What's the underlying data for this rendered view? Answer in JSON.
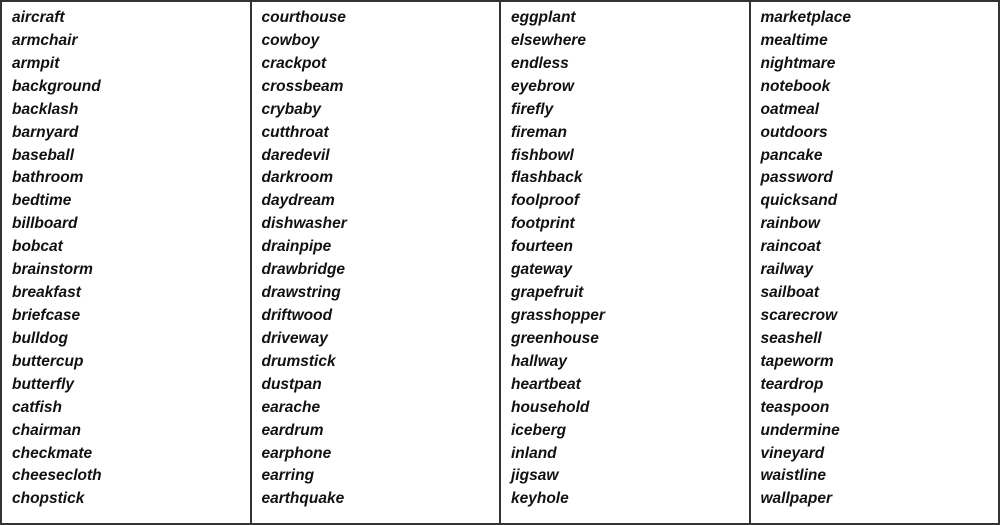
{
  "columns": [
    {
      "id": "col1",
      "words": [
        "aircraft",
        "armchair",
        "armpit",
        "background",
        "backlash",
        "barnyard",
        "baseball",
        "bathroom",
        "bedtime",
        "billboard",
        "bobcat",
        "brainstorm",
        "breakfast",
        "briefcase",
        "bulldog",
        "buttercup",
        "butterfly",
        "catfish",
        "chairman",
        "checkmate",
        "cheesecloth",
        "chopstick"
      ]
    },
    {
      "id": "col2",
      "words": [
        "courthouse",
        "cowboy",
        "crackpot",
        "crossbeam",
        "crybaby",
        "cutthroat",
        "daredevil",
        "darkroom",
        "daydream",
        "dishwasher",
        "drainpipe",
        "drawbridge",
        "drawstring",
        "driftwood",
        "driveway",
        "drumstick",
        "dustpan",
        "earache",
        "eardrum",
        "earphone",
        "earring",
        "earthquake"
      ]
    },
    {
      "id": "col3",
      "words": [
        "eggplant",
        "elsewhere",
        "endless",
        "eyebrow",
        "firefly",
        "fireman",
        "fishbowl",
        "flashback",
        "foolproof",
        "footprint",
        "fourteen",
        "gateway",
        "grapefruit",
        "grasshopper",
        "greenhouse",
        "hallway",
        "heartbeat",
        "household",
        "iceberg",
        "inland",
        "jigsaw",
        "keyhole"
      ]
    },
    {
      "id": "col4",
      "words": [
        "marketplace",
        "mealtime",
        "nightmare",
        "notebook",
        "oatmeal",
        "outdoors",
        "pancake",
        "password",
        "quicksand",
        "rainbow",
        "raincoat",
        "railway",
        "sailboat",
        "scarecrow",
        "seashell",
        "tapeworm",
        "teardrop",
        "teaspoon",
        "undermine",
        "vineyard",
        "waistline",
        "wallpaper"
      ]
    }
  ]
}
